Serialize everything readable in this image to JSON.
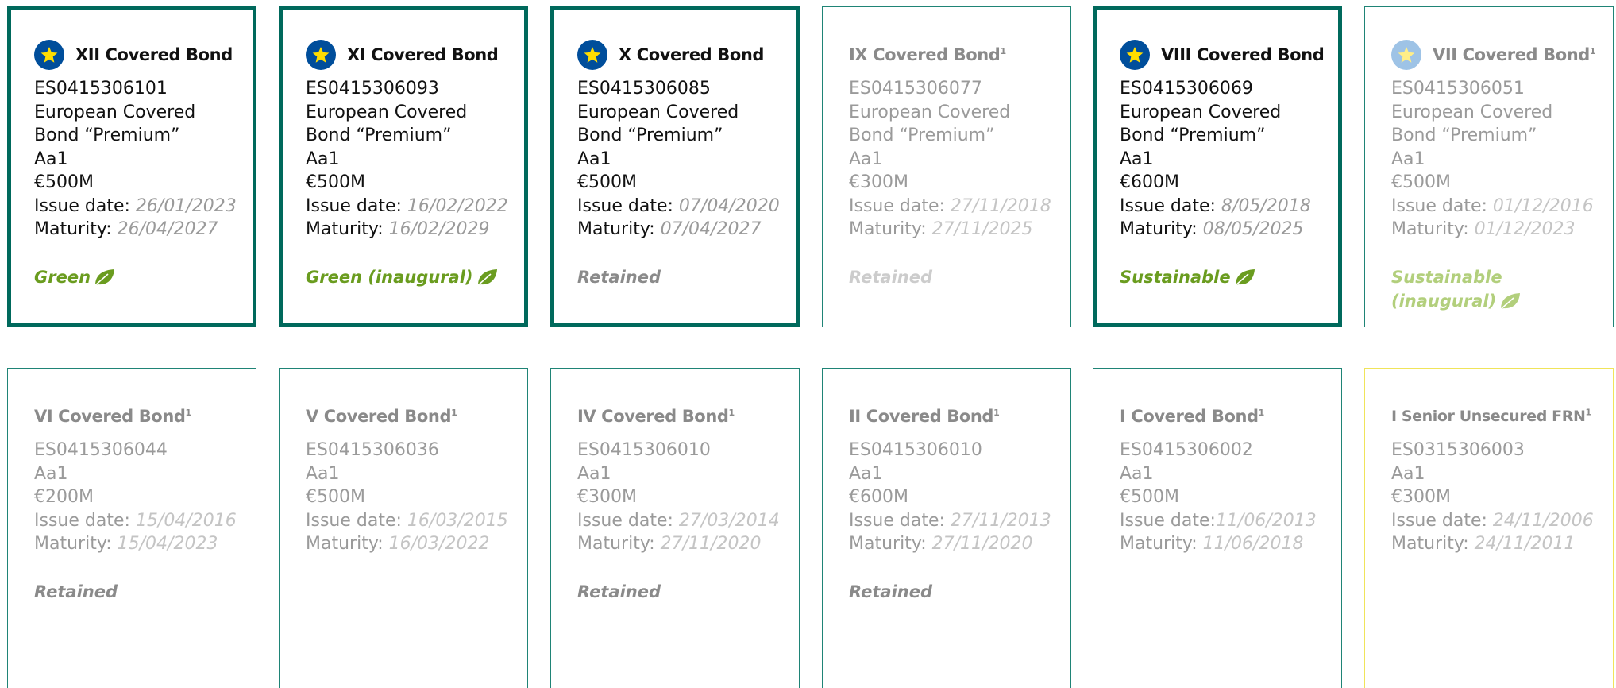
{
  "colors": {
    "active_border": "#00695c",
    "border": "#1f8476",
    "senior_border": "#f0e45a",
    "star_badge": "#004e9b",
    "star_badge_faded": "#9ec3e6",
    "star": "#ffdd00",
    "green_label": "#6a9c1f",
    "green_label_faded": "#b2cf7c",
    "grey_text": "#8a8a8a"
  },
  "icons": {
    "badge": "star-icon",
    "tag": "leaf-icon"
  },
  "row1": [
    {
      "title": "XII Covered Bond",
      "sup": "",
      "isin": "ES0415306101",
      "type1": "European Covered",
      "type2": "Bond “Premium”",
      "rating": "Aa1",
      "amount": "€500M",
      "issue_label": "Issue date: ",
      "issue_date": "26/01/2023",
      "maturity_label": "Maturity: ",
      "maturity_date": "26/04/2027",
      "tag1": "Green",
      "tag2": ""
    },
    {
      "title": "XI Covered Bond",
      "sup": "",
      "isin": "ES0415306093",
      "type1": "European Covered",
      "type2": "Bond “Premium”",
      "rating": "Aa1",
      "amount": "€500M",
      "issue_label": "Issue date: ",
      "issue_date": "16/02/2022",
      "maturity_label": "Maturity: ",
      "maturity_date": "16/02/2029",
      "tag1": "Green (inaugural)",
      "tag2": ""
    },
    {
      "title": "X Covered Bond",
      "sup": "",
      "isin": "ES0415306085",
      "type1": "European Covered",
      "type2": "Bond “Premium”",
      "rating": "Aa1",
      "amount": "€500M",
      "issue_label": "Issue date: ",
      "issue_date": "07/04/2020",
      "maturity_label": "Maturity: ",
      "maturity_date": "07/04/2027",
      "tag1": "Retained",
      "tag2": ""
    },
    {
      "title": "IX Covered Bond",
      "sup": "1",
      "isin": "ES0415306077",
      "type1": "European Covered",
      "type2": "Bond “Premium”",
      "rating": "Aa1",
      "amount": "€300M",
      "issue_label": "Issue date: ",
      "issue_date": "27/11/2018",
      "maturity_label": "Maturity: ",
      "maturity_date": "27/11/2025",
      "tag1": "Retained",
      "tag2": ""
    },
    {
      "title": "VIII Covered Bond",
      "sup": "",
      "isin": "ES0415306069",
      "type1": "European Covered",
      "type2": "Bond “Premium”",
      "rating": "Aa1",
      "amount": "€600M",
      "issue_label": "Issue date: ",
      "issue_date": "8/05/2018",
      "maturity_label": "Maturity: ",
      "maturity_date": "08/05/2025",
      "tag1": "Sustainable",
      "tag2": ""
    },
    {
      "title": "VII Covered Bond",
      "sup": "1",
      "isin": "ES0415306051",
      "type1": "European Covered",
      "type2": "Bond “Premium”",
      "rating": "Aa1",
      "amount": "€500M",
      "issue_label": "Issue date: ",
      "issue_date": "01/12/2016",
      "maturity_label": "Maturity: ",
      "maturity_date": "01/12/2023",
      "tag1": "Sustainable",
      "tag2": "(inaugural)"
    }
  ],
  "row2": [
    {
      "title": "VI Covered Bond",
      "sup": "1",
      "isin": "ES0415306044",
      "rating": "Aa1",
      "amount": "€200M",
      "issue_label": "Issue date: ",
      "issue_date": "15/04/2016",
      "maturity_label": "Maturity: ",
      "maturity_date": "15/04/2023",
      "tag1": "Retained"
    },
    {
      "title": "V Covered Bond",
      "sup": "1",
      "isin": "ES0415306036",
      "rating": "Aa1",
      "amount": "€500M",
      "issue_label": "Issue date: ",
      "issue_date": "16/03/2015",
      "maturity_label": "Maturity: ",
      "maturity_date": "16/03/2022",
      "tag1": ""
    },
    {
      "title": "IV Covered Bond",
      "sup": "1",
      "isin": "ES0415306010",
      "rating": "Aa1",
      "amount": "€300M",
      "issue_label": "Issue date: ",
      "issue_date": "27/03/2014",
      "maturity_label": "Maturity: ",
      "maturity_date": "27/11/2020",
      "tag1": "Retained"
    },
    {
      "title": "II Covered Bond",
      "sup": "1",
      "isin": "ES0415306010",
      "rating": "Aa1",
      "amount": "€600M",
      "issue_label": "Issue date: ",
      "issue_date": "27/11/2013",
      "maturity_label": "Maturity: ",
      "maturity_date": "27/11/2020",
      "tag1": "Retained"
    },
    {
      "title": "I Covered Bond",
      "sup": "1",
      "isin": "ES0415306002",
      "rating": "Aa1",
      "amount": "€500M",
      "issue_label": "Issue date:",
      "issue_date": "11/06/2013",
      "maturity_label": "Maturity: ",
      "maturity_date": "11/06/2018",
      "tag1": ""
    },
    {
      "title": "I Senior Unsecured FRN",
      "sup": "1",
      "isin": "ES0315306003",
      "rating": "Aa1",
      "amount": "€300M",
      "issue_label": "Issue date: ",
      "issue_date": "24/11/2006",
      "maturity_label": "Maturity: ",
      "maturity_date": "24/11/2011",
      "tag1": ""
    }
  ]
}
